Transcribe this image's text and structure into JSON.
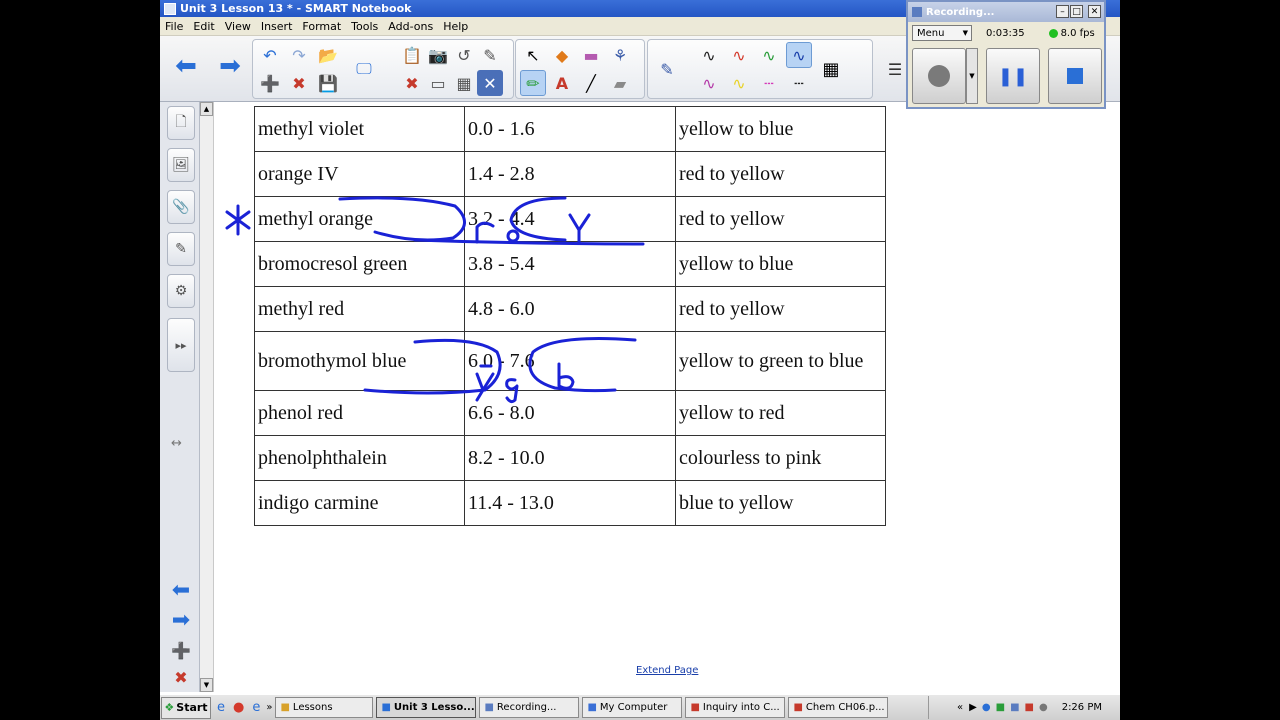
{
  "window": {
    "title": "Unit 3 Lesson 13 * - SMART Notebook"
  },
  "menu": [
    "File",
    "Edit",
    "View",
    "Insert",
    "Format",
    "Tools",
    "Add-ons",
    "Help"
  ],
  "table": {
    "rows": [
      [
        "methyl violet",
        "0.0 - 1.6",
        "yellow to blue"
      ],
      [
        "orange IV",
        "1.4 - 2.8",
        "red to yellow"
      ],
      [
        "methyl orange",
        "3.2 - 4.4",
        "red to yellow"
      ],
      [
        "bromocresol green",
        "3.8 - 5.4",
        "yellow to blue"
      ],
      [
        "methyl red",
        "4.8 - 6.0",
        "red to yellow"
      ],
      [
        "bromothymol blue",
        "6.0 - 7.6",
        "yellow to green to blue"
      ],
      [
        "phenol red",
        "6.6 - 8.0",
        "yellow to red"
      ],
      [
        "phenolphthalein",
        "8.2 - 10.0",
        "colourless to pink"
      ],
      [
        "indigo carmine",
        "11.4 - 13.0",
        "blue to yellow"
      ]
    ]
  },
  "canvas": {
    "extend_link": "Extend Page"
  },
  "recorder": {
    "title": "Recording...",
    "menu_label": "Menu",
    "time": "0:03:35",
    "fps": "8.0 fps"
  },
  "taskbar": {
    "start_label": "Start",
    "tasks": [
      "Lessons",
      "Unit 3 Lesso...",
      "Recording...",
      "My Computer",
      "Inquiry into C...",
      "Chem CH06.p..."
    ],
    "clock": "2:26 PM"
  },
  "colors": {
    "ink": "#1a22d6",
    "accent": "#2a6fd6"
  }
}
